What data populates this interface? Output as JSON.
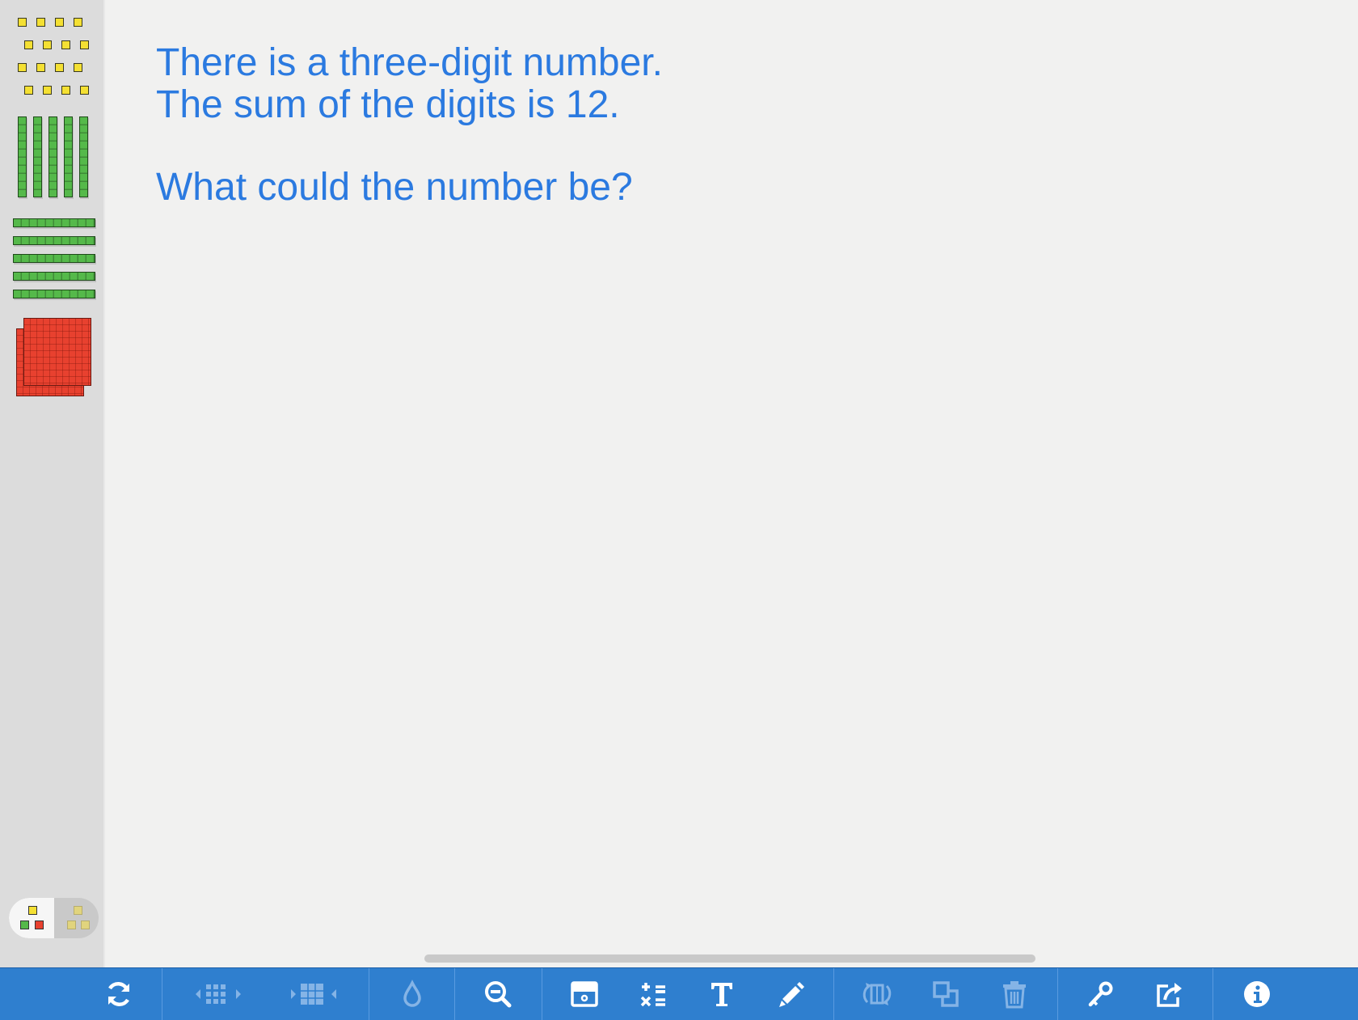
{
  "prompt": {
    "line1": "There is a three-digit number.",
    "line2": "The sum of the digits is 12.",
    "line3": "What could the number be?"
  },
  "colors": {
    "text_blue": "#2b7ae0",
    "toolbar_blue": "#2f7fcf",
    "unit_yellow": "#f4e033",
    "rod_green": "#55b94a",
    "flat_red": "#e8412f"
  },
  "sidebar": {
    "items": [
      {
        "name": "ones",
        "icon": "unit-cubes"
      },
      {
        "name": "tens-vertical",
        "icon": "vertical-rods"
      },
      {
        "name": "tens-horizontal",
        "icon": "horizontal-rods"
      },
      {
        "name": "hundreds",
        "icon": "hundred-flats"
      }
    ],
    "palette_toggle": {
      "left": "color-blocks-icon",
      "right": "plain-blocks-icon"
    }
  },
  "toolbar": {
    "tools": [
      {
        "name": "reset-icon",
        "enabled": true
      },
      {
        "name": "ungroup-icon",
        "enabled": false
      },
      {
        "name": "group-icon",
        "enabled": false
      },
      {
        "name": "color-drop-icon",
        "enabled": false
      },
      {
        "name": "zoom-out-icon",
        "enabled": true
      },
      {
        "name": "screen-cover-icon",
        "enabled": true
      },
      {
        "name": "operations-icon",
        "enabled": true
      },
      {
        "name": "text-icon",
        "enabled": true
      },
      {
        "name": "pencil-icon",
        "enabled": true
      },
      {
        "name": "rotate-icon",
        "enabled": false
      },
      {
        "name": "duplicate-icon",
        "enabled": false
      },
      {
        "name": "trash-icon",
        "enabled": false
      },
      {
        "name": "key-icon",
        "enabled": true
      },
      {
        "name": "share-icon",
        "enabled": true
      },
      {
        "name": "info-icon",
        "enabled": true
      }
    ]
  }
}
